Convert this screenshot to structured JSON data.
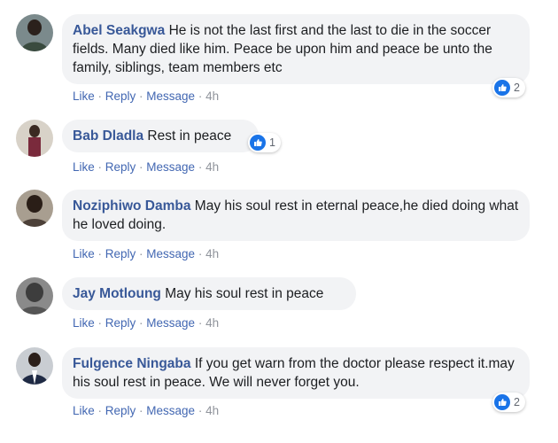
{
  "actions": {
    "like": "Like",
    "reply": "Reply",
    "message": "Message",
    "sep": " · "
  },
  "comments": [
    {
      "author": "Abel Seakgwa",
      "text": "He is not the last first and the last to die in the soccer fields. Many died like him. Peace be upon him and peace be unto the family, siblings, team members etc",
      "time": "4h",
      "reactions": "2"
    },
    {
      "author": "Bab Dladla",
      "text": "Rest in peace",
      "time": "4h",
      "reactions": "1"
    },
    {
      "author": "Noziphiwo Damba",
      "text": "May his soul rest in eternal peace,he died doing what he loved doing.",
      "time": "4h"
    },
    {
      "author": "Jay Motloung",
      "text": "May his soul rest in peace",
      "time": "4h"
    },
    {
      "author": "Fulgence Ningaba",
      "text": "If you get warn from the doctor please respect it.may his soul rest in peace. We will never forget you.",
      "time": "4h",
      "reactions": "2"
    }
  ]
}
